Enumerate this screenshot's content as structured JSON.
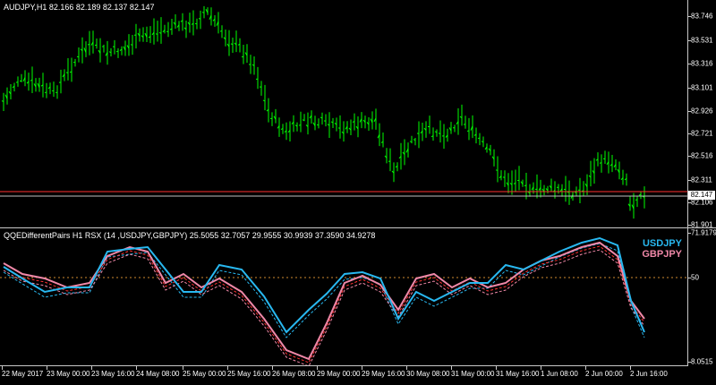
{
  "main": {
    "title": "AUDJPY,H1  82.166 82.189 82.137 82.147",
    "price_ticks": [
      "83.746",
      "83.531",
      "83.316",
      "83.101",
      "82.926",
      "82.721",
      "82.516",
      "82.311",
      "82.106",
      "81.901"
    ],
    "current_price": "82.147",
    "bar_color": "#00ff00",
    "lines_color": "#ff3030"
  },
  "indicator": {
    "title": "QQEDifferentPairs H1 RSX (14 ,USDJPY,GBPJPY)  25.5055 32.7057 29.9555 30.9939 37.3590 34.9278",
    "ticks": [
      "71.9179",
      "50",
      "8.0515"
    ],
    "legend": [
      {
        "label": "USDJPY",
        "color": "#28b8f0"
      },
      {
        "label": "GBPJPY",
        "color": "#f088a8"
      }
    ]
  },
  "time_axis": [
    "22 May 2017",
    "23 May 00:00",
    "23 May 16:00",
    "24 May 08:00",
    "25 May 00:00",
    "25 May 16:00",
    "26 May 08:00",
    "29 May 00:00",
    "29 May 16:00",
    "30 May 08:00",
    "31 May 00:00",
    "31 May 16:00",
    "1 Jun 08:00",
    "2 Jun 00:00",
    "2 Jun 16:00"
  ]
}
